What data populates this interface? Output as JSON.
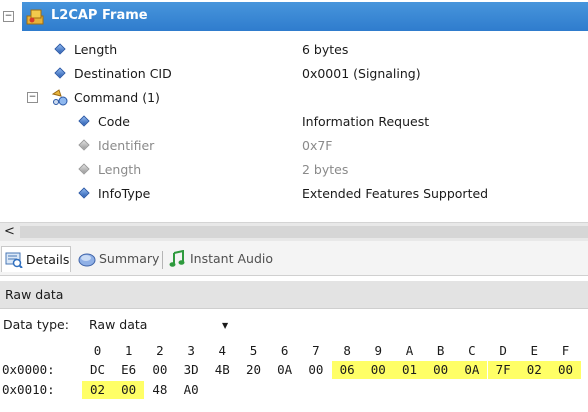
{
  "tree": {
    "frame_title": "L2CAP Frame",
    "collapse_glyph": "⊟",
    "rows": [
      {
        "label": "Length",
        "value": "6 bytes"
      },
      {
        "label": "Destination CID",
        "value": "0x0001 (Signaling)"
      },
      {
        "label": "Command (1)",
        "value": ""
      },
      {
        "label": "Code",
        "value": "Information Request"
      },
      {
        "label": "Identifier",
        "value": "0x7F"
      },
      {
        "label": "Length",
        "value": "2 bytes"
      },
      {
        "label": "InfoType",
        "value": "Extended Features Supported"
      }
    ]
  },
  "scroll": {
    "left_arrow": "<"
  },
  "tabs": [
    {
      "label": "Details",
      "icon": "details-icon"
    },
    {
      "label": "Summary",
      "icon": "summary-icon"
    },
    {
      "label": "Instant Audio",
      "icon": "music-note-icon"
    }
  ],
  "raw": {
    "header": "Raw data",
    "type_label": "Data type:",
    "type_value": "Raw data",
    "columns": [
      "0",
      "1",
      "2",
      "3",
      "4",
      "5",
      "6",
      "7",
      "8",
      "9",
      "A",
      "B",
      "C",
      "D",
      "E",
      "F"
    ],
    "lines": [
      {
        "address": "0x0000:",
        "bytes": [
          "DC",
          "E6",
          "00",
          "3D",
          "4B",
          "20",
          "0A",
          "00",
          "06",
          "00",
          "01",
          "00",
          "0A",
          "7F",
          "02",
          "00"
        ]
      },
      {
        "address": "0x0010:",
        "bytes": [
          "02",
          "00",
          "48",
          "A0"
        ]
      }
    ],
    "highlight_color": "#ffff66"
  },
  "colors": {
    "header_blue": "#3a86d4",
    "icon_blue": "#2b5fb3"
  }
}
